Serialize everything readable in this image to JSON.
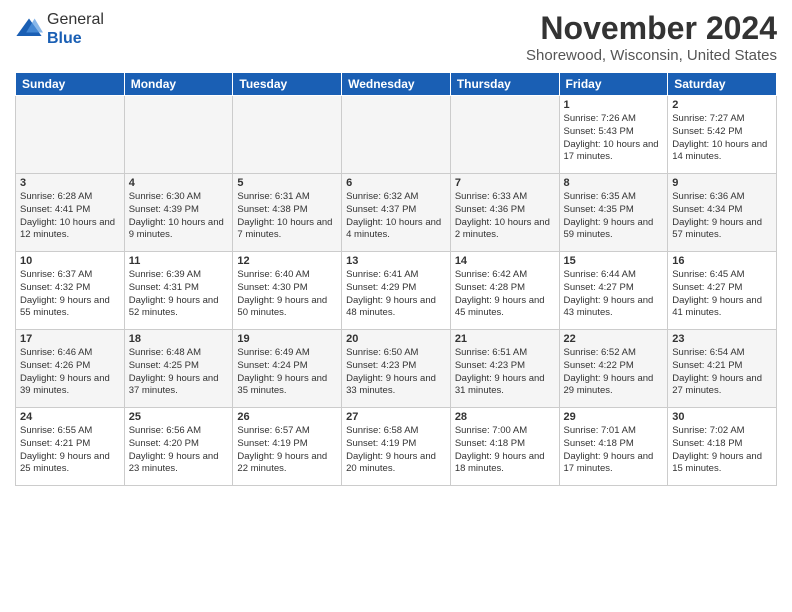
{
  "logo": {
    "general": "General",
    "blue": "Blue"
  },
  "title": "November 2024",
  "location": "Shorewood, Wisconsin, United States",
  "weekdays": [
    "Sunday",
    "Monday",
    "Tuesday",
    "Wednesday",
    "Thursday",
    "Friday",
    "Saturday"
  ],
  "weeks": [
    [
      {
        "day": "",
        "info": ""
      },
      {
        "day": "",
        "info": ""
      },
      {
        "day": "",
        "info": ""
      },
      {
        "day": "",
        "info": ""
      },
      {
        "day": "",
        "info": ""
      },
      {
        "day": "1",
        "info": "Sunrise: 7:26 AM\nSunset: 5:43 PM\nDaylight: 10 hours and 17 minutes."
      },
      {
        "day": "2",
        "info": "Sunrise: 7:27 AM\nSunset: 5:42 PM\nDaylight: 10 hours and 14 minutes."
      }
    ],
    [
      {
        "day": "3",
        "info": "Sunrise: 6:28 AM\nSunset: 4:41 PM\nDaylight: 10 hours and 12 minutes."
      },
      {
        "day": "4",
        "info": "Sunrise: 6:30 AM\nSunset: 4:39 PM\nDaylight: 10 hours and 9 minutes."
      },
      {
        "day": "5",
        "info": "Sunrise: 6:31 AM\nSunset: 4:38 PM\nDaylight: 10 hours and 7 minutes."
      },
      {
        "day": "6",
        "info": "Sunrise: 6:32 AM\nSunset: 4:37 PM\nDaylight: 10 hours and 4 minutes."
      },
      {
        "day": "7",
        "info": "Sunrise: 6:33 AM\nSunset: 4:36 PM\nDaylight: 10 hours and 2 minutes."
      },
      {
        "day": "8",
        "info": "Sunrise: 6:35 AM\nSunset: 4:35 PM\nDaylight: 9 hours and 59 minutes."
      },
      {
        "day": "9",
        "info": "Sunrise: 6:36 AM\nSunset: 4:34 PM\nDaylight: 9 hours and 57 minutes."
      }
    ],
    [
      {
        "day": "10",
        "info": "Sunrise: 6:37 AM\nSunset: 4:32 PM\nDaylight: 9 hours and 55 minutes."
      },
      {
        "day": "11",
        "info": "Sunrise: 6:39 AM\nSunset: 4:31 PM\nDaylight: 9 hours and 52 minutes."
      },
      {
        "day": "12",
        "info": "Sunrise: 6:40 AM\nSunset: 4:30 PM\nDaylight: 9 hours and 50 minutes."
      },
      {
        "day": "13",
        "info": "Sunrise: 6:41 AM\nSunset: 4:29 PM\nDaylight: 9 hours and 48 minutes."
      },
      {
        "day": "14",
        "info": "Sunrise: 6:42 AM\nSunset: 4:28 PM\nDaylight: 9 hours and 45 minutes."
      },
      {
        "day": "15",
        "info": "Sunrise: 6:44 AM\nSunset: 4:27 PM\nDaylight: 9 hours and 43 minutes."
      },
      {
        "day": "16",
        "info": "Sunrise: 6:45 AM\nSunset: 4:27 PM\nDaylight: 9 hours and 41 minutes."
      }
    ],
    [
      {
        "day": "17",
        "info": "Sunrise: 6:46 AM\nSunset: 4:26 PM\nDaylight: 9 hours and 39 minutes."
      },
      {
        "day": "18",
        "info": "Sunrise: 6:48 AM\nSunset: 4:25 PM\nDaylight: 9 hours and 37 minutes."
      },
      {
        "day": "19",
        "info": "Sunrise: 6:49 AM\nSunset: 4:24 PM\nDaylight: 9 hours and 35 minutes."
      },
      {
        "day": "20",
        "info": "Sunrise: 6:50 AM\nSunset: 4:23 PM\nDaylight: 9 hours and 33 minutes."
      },
      {
        "day": "21",
        "info": "Sunrise: 6:51 AM\nSunset: 4:23 PM\nDaylight: 9 hours and 31 minutes."
      },
      {
        "day": "22",
        "info": "Sunrise: 6:52 AM\nSunset: 4:22 PM\nDaylight: 9 hours and 29 minutes."
      },
      {
        "day": "23",
        "info": "Sunrise: 6:54 AM\nSunset: 4:21 PM\nDaylight: 9 hours and 27 minutes."
      }
    ],
    [
      {
        "day": "24",
        "info": "Sunrise: 6:55 AM\nSunset: 4:21 PM\nDaylight: 9 hours and 25 minutes."
      },
      {
        "day": "25",
        "info": "Sunrise: 6:56 AM\nSunset: 4:20 PM\nDaylight: 9 hours and 23 minutes."
      },
      {
        "day": "26",
        "info": "Sunrise: 6:57 AM\nSunset: 4:19 PM\nDaylight: 9 hours and 22 minutes."
      },
      {
        "day": "27",
        "info": "Sunrise: 6:58 AM\nSunset: 4:19 PM\nDaylight: 9 hours and 20 minutes."
      },
      {
        "day": "28",
        "info": "Sunrise: 7:00 AM\nSunset: 4:18 PM\nDaylight: 9 hours and 18 minutes."
      },
      {
        "day": "29",
        "info": "Sunrise: 7:01 AM\nSunset: 4:18 PM\nDaylight: 9 hours and 17 minutes."
      },
      {
        "day": "30",
        "info": "Sunrise: 7:02 AM\nSunset: 4:18 PM\nDaylight: 9 hours and 15 minutes."
      }
    ]
  ]
}
